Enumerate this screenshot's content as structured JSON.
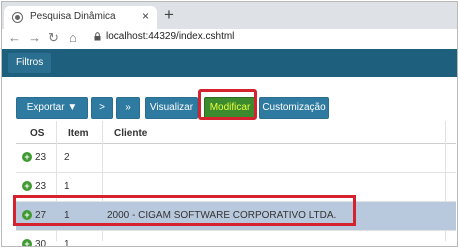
{
  "browser": {
    "tab_title": "Pesquisa Dinâmica",
    "tab_close": "×",
    "new_tab": "+",
    "url": "localhost:44329/index.cshtml"
  },
  "app": {
    "filters_label": "Filtros"
  },
  "toolbar": {
    "export_label": "Exportar ▼",
    "next_label": ">",
    "last_label": "»",
    "view_label": "Visualizar",
    "modify_label": "Modificar",
    "customize_label": "Customização"
  },
  "grid": {
    "columns": [
      "OS",
      "Item",
      "Cliente"
    ],
    "rows": [
      {
        "os": "23",
        "item": "2",
        "cliente": "",
        "selected": false
      },
      {
        "os": "23",
        "item": "1",
        "cliente": "",
        "selected": false
      },
      {
        "os": "27",
        "item": "1",
        "cliente": "2000 - CIGAM SOFTWARE CORPORATIVO LTDA.",
        "selected": true
      },
      {
        "os": "30",
        "item": "1",
        "cliente": "",
        "selected": false
      }
    ]
  },
  "colors": {
    "app_bar": "#1f5f7e",
    "button": "#2f7aa0",
    "modify_button": "#3c8a2e",
    "highlight": "#d4222e",
    "selected_row": "#b8c9dd"
  }
}
